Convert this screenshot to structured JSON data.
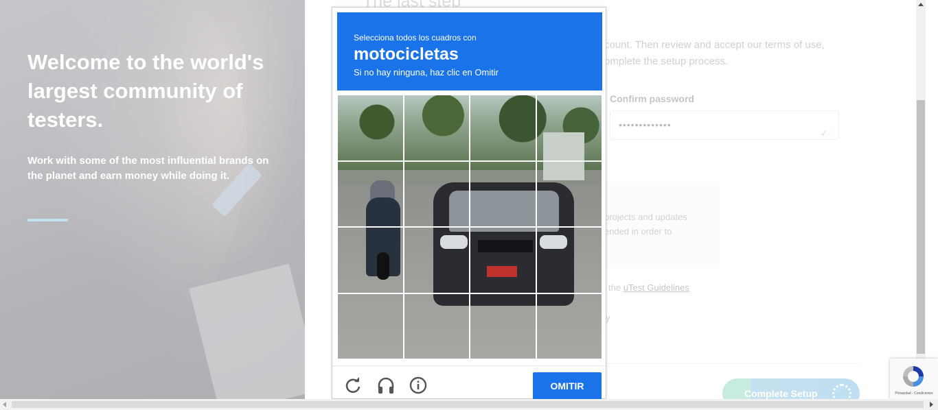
{
  "hero": {
    "title": "Welcome to the world's largest community of testers.",
    "subtitle": "Work with some of the most influential brands on the planet and earn money while doing it.",
    "accent_color": "#7ec9dc"
  },
  "form": {
    "heading": "The last step",
    "intro": "count. Then review and accept our terms of use, omplete the setup process.",
    "confirm_password_label": "Confirm password",
    "confirm_password_value": "•••••••••••••",
    "info_text": "projects and updates ended in order to",
    "guidelines_prefix": "the",
    "guidelines_link": "uTest Guidelines",
    "policy_tail": "y",
    "complete_button": "Complete Setup"
  },
  "captcha": {
    "instruction": "Selecciona todos los cuadros con",
    "target": "motocicletas",
    "skip_hint": "Si no hay ninguna, haz clic en Omitir",
    "skip_button": "OMITIR",
    "header_color": "#1a73e8",
    "grid_size": "4x4",
    "icons": [
      "reload-icon",
      "headphones-icon",
      "info-icon"
    ]
  },
  "badge": {
    "text": "Privacidad - Condiciones"
  }
}
